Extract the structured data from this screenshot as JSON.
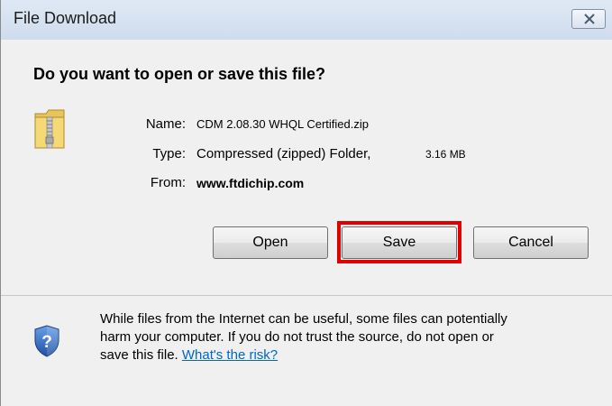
{
  "window": {
    "title": "File Download",
    "close_symbol": "✕",
    "close_icon": "close-icon"
  },
  "dialog": {
    "heading": "Do you want to open or save this file?",
    "file_icon": "zip-folder-icon",
    "name_label": "Name:",
    "name_value": "CDM 2.08.30 WHQL Certified.zip",
    "type_label": "Type:",
    "type_value": "Compressed (zipped) Folder,",
    "type_size": "3.16 MB",
    "from_label": "From:",
    "from_value": "www.ftdichip.com"
  },
  "buttons": {
    "open": "Open",
    "save": "Save",
    "cancel": "Cancel"
  },
  "highlight": {
    "target": "save-button",
    "color": "#e00000"
  },
  "warning": {
    "icon": "shield-question-icon",
    "text_line1": "While files from the Internet can be useful, some files can potentially",
    "text_line2": "harm your computer. If you do not trust the source, do not open or",
    "text_line3": "save this file.",
    "risk_link": "What's the risk?"
  }
}
